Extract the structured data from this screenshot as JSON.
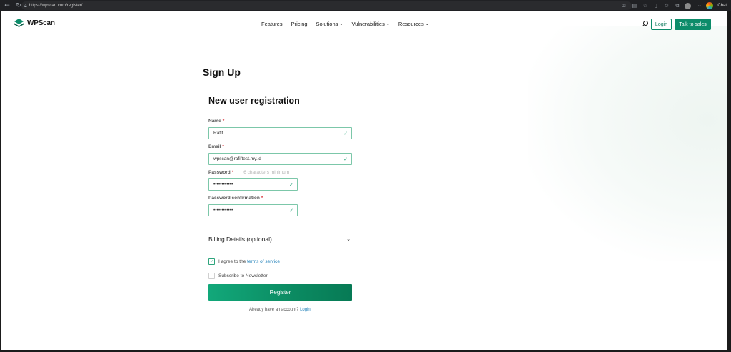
{
  "browser": {
    "url": "https://wpscan.com/register/",
    "profile_label": "Chat"
  },
  "nav": {
    "logo_text": "WPScan",
    "menu": [
      {
        "label": "Features",
        "has_dropdown": false
      },
      {
        "label": "Pricing",
        "has_dropdown": false
      },
      {
        "label": "Solutions",
        "has_dropdown": true
      },
      {
        "label": "Vulnerabilities",
        "has_dropdown": true
      },
      {
        "label": "Resources",
        "has_dropdown": true
      }
    ],
    "login_label": "Login",
    "sales_label": "Talk to sales"
  },
  "page": {
    "title": "Sign Up"
  },
  "form": {
    "title": "New user registration",
    "name": {
      "label": "Name",
      "required_mark": "*",
      "value": "Rafif"
    },
    "email": {
      "label": "Email",
      "required_mark": "*",
      "value": "wpscan@rafiftest.my.id"
    },
    "password": {
      "label": "Password",
      "required_mark": "*",
      "hint": "6 characters minimum",
      "value": "••••••••••••"
    },
    "password_confirmation": {
      "label": "Password confirmation",
      "required_mark": "*",
      "value": "••••••••••••"
    },
    "billing": {
      "label": "Billing Details (optional)"
    },
    "terms": {
      "prefix": "I agree to the",
      "link": "terms of service",
      "checked": true
    },
    "newsletter": {
      "label": "Subscribe to Newsletter",
      "checked": false
    },
    "register_label": "Register",
    "already": {
      "prefix": "Already have an account?",
      "link": "Login"
    }
  },
  "colors": {
    "brand": "#0d8c6a",
    "field_border": "#7cc7a9",
    "link": "#1d7fb8",
    "required": "#d9363e"
  }
}
